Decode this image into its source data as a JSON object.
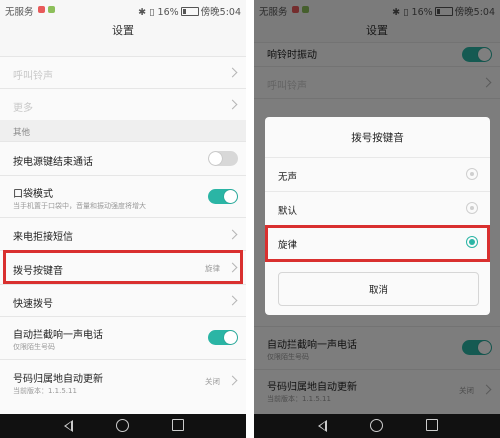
{
  "status": {
    "left": {
      "carrier": "无服务",
      "battery": "16%",
      "time": "傍晚5:04"
    },
    "right": {
      "carrier": "无服务",
      "battery": "16%",
      "time": "傍晚5:04"
    }
  },
  "title": "设置",
  "left_screen": {
    "rows": {
      "ringtone": "呼叫铃声",
      "more": "更多",
      "section_other": "其他",
      "power_end_call": "按电源键结束通话",
      "pocket_mode": "口袋模式",
      "pocket_mode_sub": "当手机置于口袋中，音量和振动强度将增大",
      "reject_sms": "来电拒接短信",
      "dial_tone": "拨号按键音",
      "dial_tone_value": "旋律",
      "speed_dial": "快速拨号",
      "intercept": "自动拦截响一声电话",
      "intercept_sub": "仅限陌生号码",
      "auto_update": "号码归属地自动更新",
      "auto_update_sub": "当前版本：1.1.5.11",
      "auto_update_value": "关闭"
    },
    "toggles": {
      "power_end_call": false,
      "pocket_mode": true,
      "intercept": true
    }
  },
  "right_screen": {
    "bg_rows": {
      "ring_vibrate": "响铃时振动",
      "ringtone": "呼叫铃声",
      "intercept": "自动拦截响一声电话",
      "intercept_sub": "仅限陌生号码",
      "auto_update": "号码归属地自动更新",
      "auto_update_sub": "当前版本：1.1.5.11",
      "auto_update_value": "关闭"
    },
    "dialog": {
      "title": "拨号按键音",
      "options": [
        "无声",
        "默认",
        "旋律"
      ],
      "selected_index": 2,
      "cancel": "取消"
    }
  },
  "colors": {
    "accent": "#2bb5a5",
    "highlight": "#d9302f"
  },
  "icons": [
    "bluetooth-icon",
    "vibrate-icon",
    "battery-icon",
    "back-icon",
    "home-icon",
    "recent-apps-icon"
  ]
}
